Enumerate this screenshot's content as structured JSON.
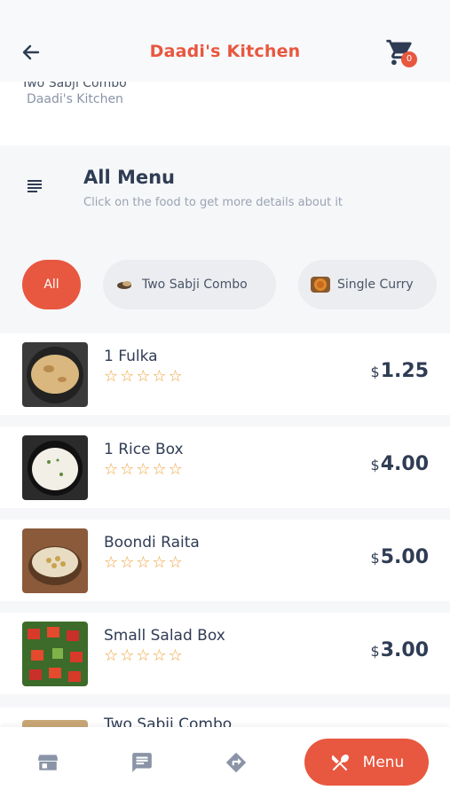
{
  "header": {
    "title": "Daadi's Kitchen",
    "cart_count": "0"
  },
  "hero": {
    "name": "Two Sabji Combo",
    "restaurant": "Daadi's Kitchen"
  },
  "menu": {
    "title": "All Menu",
    "subtitle": "Click on the food to get more details about it"
  },
  "categories": [
    {
      "label": "All",
      "selected": true
    },
    {
      "label": "Two Sabji Combo"
    },
    {
      "label": "Single Curry"
    }
  ],
  "items": [
    {
      "name": "1 Fulka",
      "currency": "$",
      "price": "1.25",
      "stars": "☆☆☆☆☆"
    },
    {
      "name": "1 Rice Box",
      "currency": "$",
      "price": "4.00",
      "stars": "☆☆☆☆☆"
    },
    {
      "name": "Boondi Raita",
      "currency": "$",
      "price": "5.00",
      "stars": "☆☆☆☆☆"
    },
    {
      "name": "Small Salad Box",
      "currency": "$",
      "price": "3.00",
      "stars": "☆☆☆☆☆"
    },
    {
      "name": "Two Sabji Combo"
    }
  ],
  "bottom_nav": {
    "menu_label": "Menu"
  },
  "colors": {
    "accent": "#e8573f",
    "text": "#2f3c54",
    "star": "#f0a23c"
  }
}
